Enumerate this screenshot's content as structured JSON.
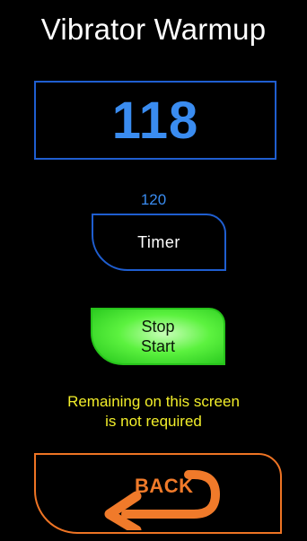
{
  "screen": {
    "title": "Vibrator Warmup"
  },
  "counter": {
    "value": "118"
  },
  "timer": {
    "preset": "120",
    "button_label": "Timer"
  },
  "stop_start": {
    "line1": "Stop",
    "line2": "Start"
  },
  "notice": {
    "line1": "Remaining on this screen",
    "line2": "is not required"
  },
  "back": {
    "label": "BACK",
    "icon": "return-arrow-icon"
  },
  "colors": {
    "background": "#000000",
    "blue_accent": "#3a8cf0",
    "blue_border": "#1f5ed0",
    "green": "#4be63a",
    "yellow_text": "#f2ee2a",
    "orange": "#ee7424"
  }
}
